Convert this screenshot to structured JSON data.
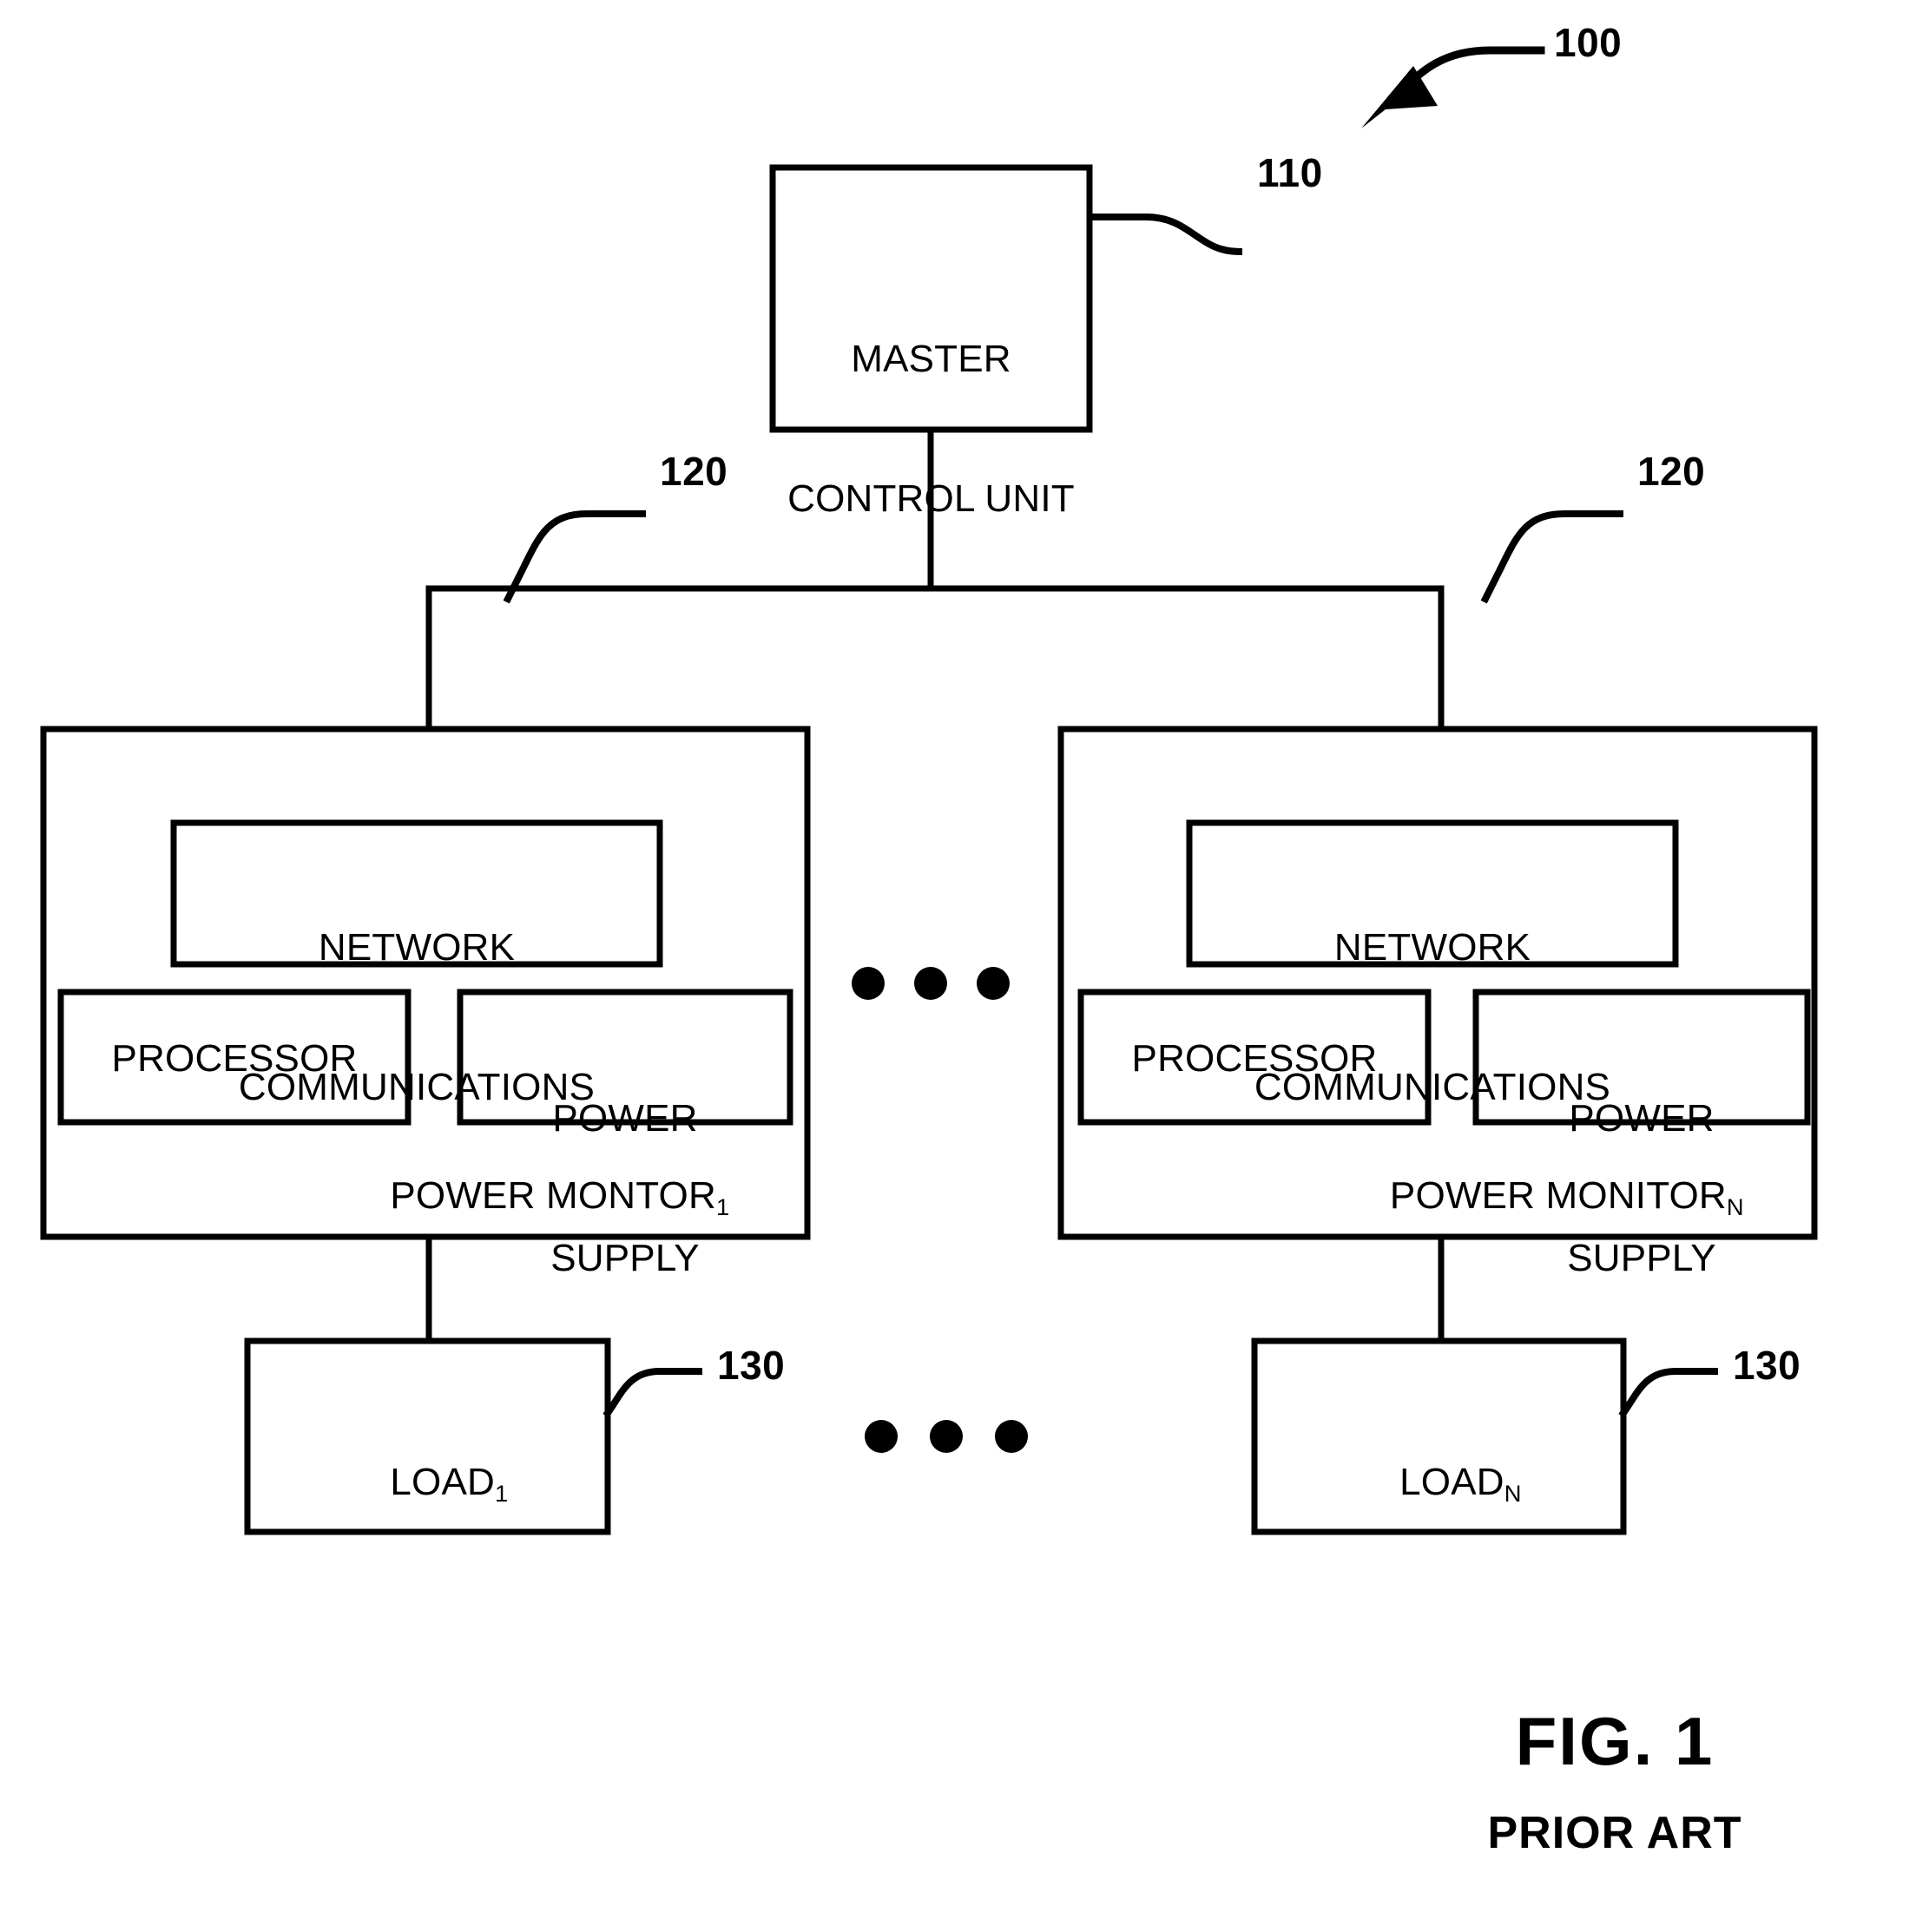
{
  "figure": {
    "title": "FIG. 1",
    "subtitle": "PRIOR ART",
    "system_ref": "100"
  },
  "master_control_unit": {
    "line1": "MASTER",
    "line2": "CONTROL UNIT",
    "ref": "110"
  },
  "power_monitors": [
    {
      "ref": "120",
      "network": {
        "line1": "NETWORK",
        "line2": "COMMUNICATIONS"
      },
      "processor": "PROCESSOR",
      "power_supply": {
        "line1": "POWER",
        "line2": "SUPPLY"
      },
      "name": "POWER MONTOR",
      "name_subscript": "1"
    },
    {
      "ref": "120",
      "network": {
        "line1": "NETWORK",
        "line2": "COMMUNICATIONS"
      },
      "processor": "PROCESSOR",
      "power_supply": {
        "line1": "POWER",
        "line2": "SUPPLY"
      },
      "name": "POWER MONITOR",
      "name_subscript": "N"
    }
  ],
  "loads": [
    {
      "name": "LOAD",
      "name_subscript": "1",
      "ref": "130"
    },
    {
      "name": "LOAD",
      "name_subscript": "N",
      "ref": "130"
    }
  ],
  "ellipsis": {
    "monitor_row_glyph": "• • •",
    "load_row_glyph": "• • •"
  },
  "colors": {
    "ink": "#000000",
    "paper": "#ffffff"
  }
}
